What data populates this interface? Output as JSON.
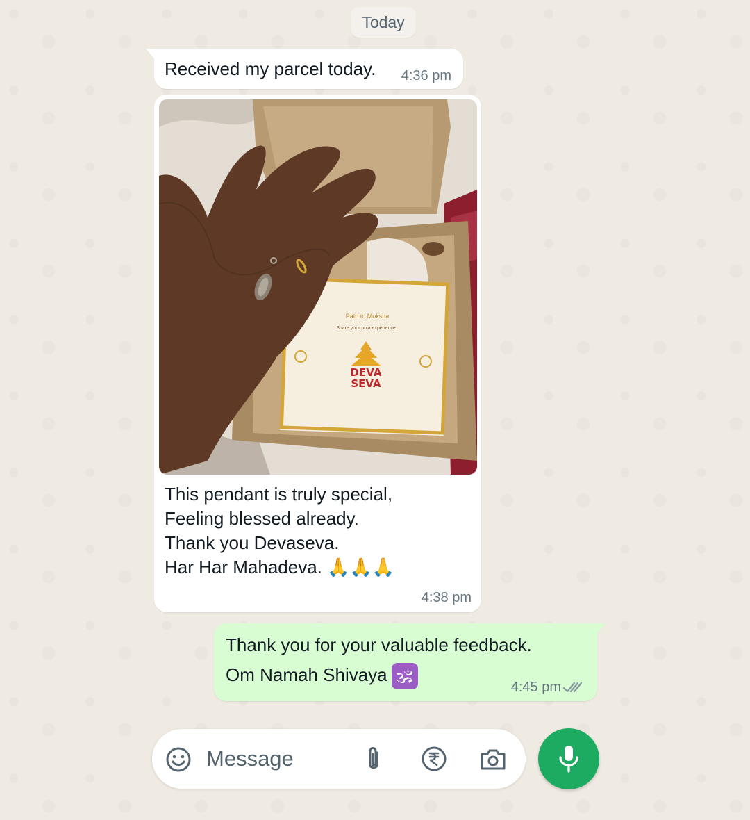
{
  "chat": {
    "date_label": "Today",
    "messages": [
      {
        "direction": "incoming",
        "type": "text",
        "text": "Received my parcel today.",
        "time": "4:36 pm"
      },
      {
        "direction": "incoming",
        "type": "image",
        "image_text": {
          "card_line1": "Path to Moksha",
          "card_line2": "Share your puja experience",
          "logo_line1": "DEVA",
          "logo_line2": "SEVA"
        },
        "caption_lines": [
          "This pendant is truly special,",
          "Feeling blessed already.",
          "Thank you Devaseva.",
          "Har Har Mahadeva. 🙏🙏🙏"
        ],
        "time": "4:38 pm"
      },
      {
        "direction": "outgoing",
        "type": "text",
        "lines": [
          "Thank you for your valuable feedback.",
          "Om Namah Shivaya"
        ],
        "emoji": "🕉",
        "time": "4:45 pm",
        "status": "read"
      }
    ]
  },
  "composer": {
    "placeholder": "Message",
    "icons": [
      "emoji-icon",
      "paperclip-icon",
      "rupee-icon",
      "camera-icon",
      "mic-icon"
    ]
  },
  "colors": {
    "background": "#efeae2",
    "incoming_bubble": "#ffffff",
    "outgoing_bubble": "#d9fdd3",
    "accent_green": "#1daa61",
    "timestamp": "#667781"
  }
}
